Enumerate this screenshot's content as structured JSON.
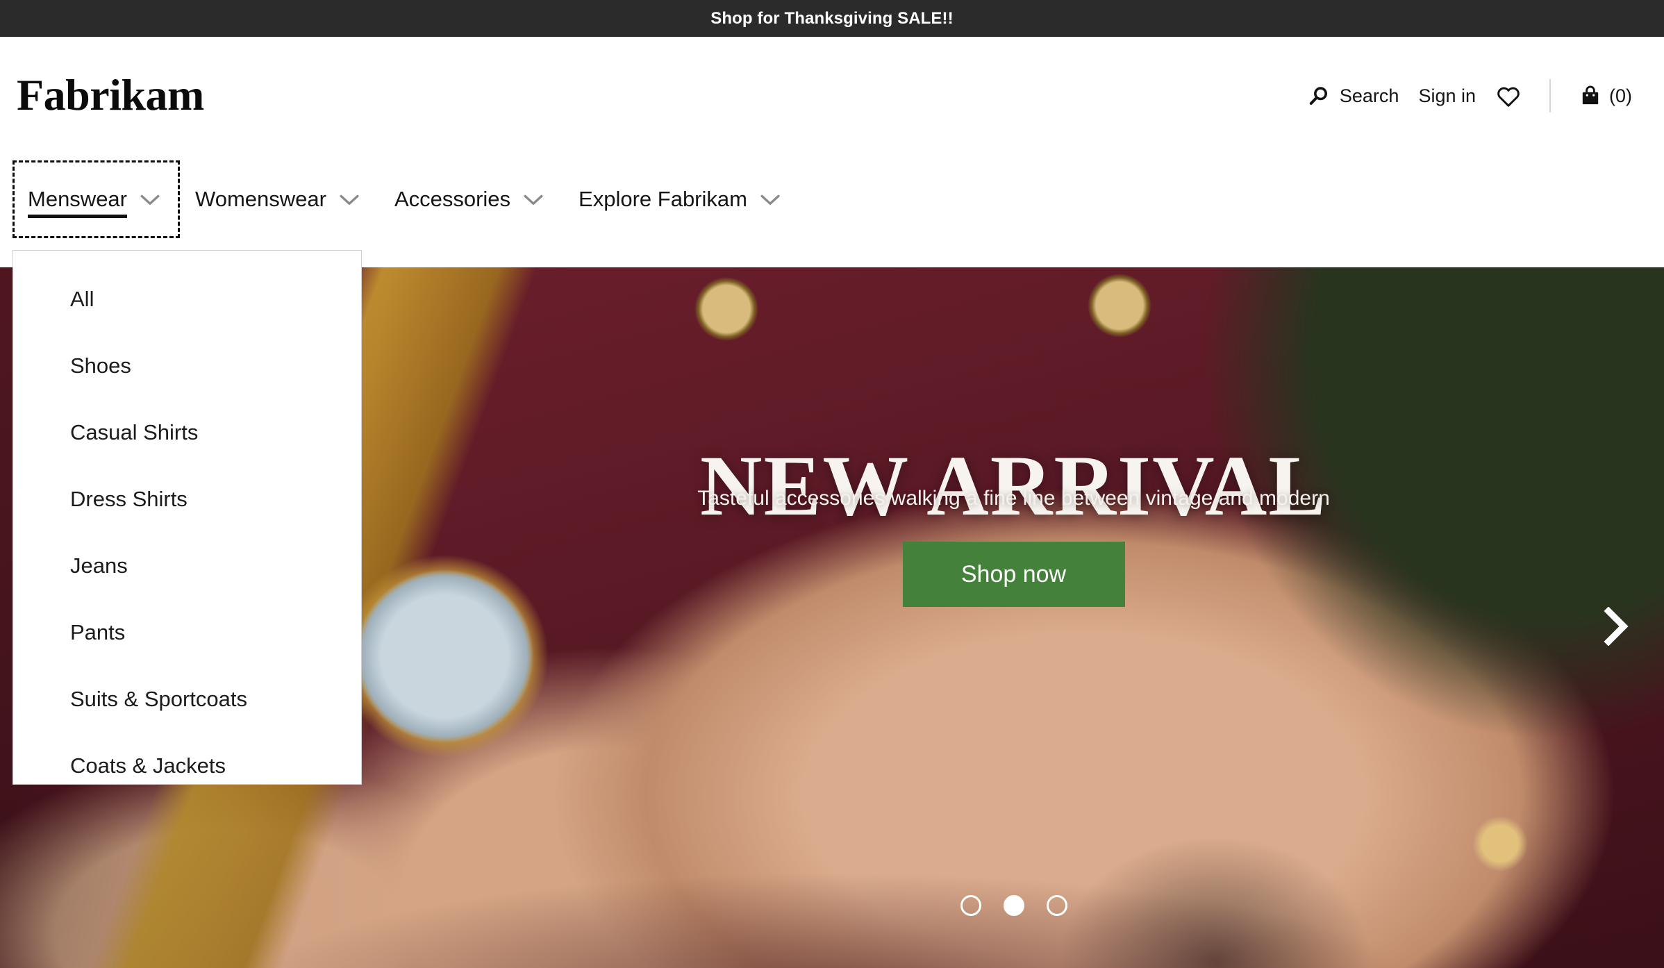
{
  "promo_banner": {
    "text": "Shop for Thanksgiving SALE!!",
    "background_color": "#2b2b2b",
    "text_color": "#ffffff"
  },
  "header": {
    "brand": "Fabrikam",
    "actions": {
      "search_label": "Search",
      "search_icon": "search-icon",
      "signin_label": "Sign in",
      "wishlist_icon": "heart-icon",
      "cart_icon": "shopping-bag-icon",
      "cart_count_label": "(0)"
    }
  },
  "nav": {
    "items": [
      {
        "label": "Menswear",
        "active": true,
        "focused": true,
        "chevron": "chevron-down-icon"
      },
      {
        "label": "Womenswear",
        "active": false,
        "focused": false,
        "chevron": "chevron-down-icon"
      },
      {
        "label": "Accessories",
        "active": false,
        "focused": false,
        "chevron": "chevron-down-icon"
      },
      {
        "label": "Explore Fabrikam",
        "active": false,
        "focused": false,
        "chevron": "chevron-down-icon"
      }
    ]
  },
  "dropdown": {
    "open_for": "Menswear",
    "items": [
      {
        "label": "All"
      },
      {
        "label": "Shoes"
      },
      {
        "label": "Casual Shirts"
      },
      {
        "label": "Dress Shirts"
      },
      {
        "label": "Jeans"
      },
      {
        "label": "Pants"
      },
      {
        "label": "Suits & Sportcoats"
      },
      {
        "label": "Coats & Jackets"
      }
    ]
  },
  "hero": {
    "title": "NEW ARRIVAL",
    "subtitle": "Tasteful accessories walking a fine line between vintage and modern",
    "cta_label": "Shop now",
    "cta_color": "#44813a",
    "next_arrow_icon": "chevron-right-icon",
    "carousel": {
      "total_slides": 3,
      "active_slide": 2
    }
  }
}
